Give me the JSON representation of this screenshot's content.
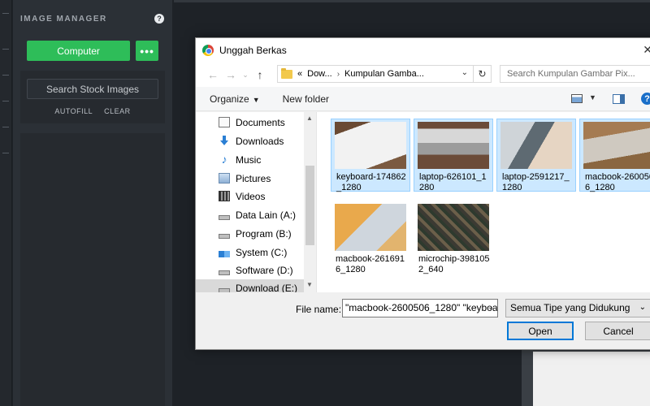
{
  "app": {
    "panel_title": "IMAGE MANAGER",
    "help_glyph": "?",
    "computer_label": "Computer",
    "more_label": "•••",
    "stock_label": "Search Stock Images",
    "autofill_label": "AUTOFILL",
    "clear_label": "CLEAR"
  },
  "dialog": {
    "title": "Unggah Berkas",
    "breadcrumb": {
      "prefix": "«",
      "parts": [
        "Dow...",
        "Kumpulan Gamba..."
      ]
    },
    "search_placeholder": "Search Kumpulan Gambar Pix...",
    "toolbar": {
      "organize": "Organize",
      "new_folder": "New folder"
    },
    "nav_items": [
      {
        "label": "Documents",
        "icon": "documents-icon"
      },
      {
        "label": "Downloads",
        "icon": "downloads-icon"
      },
      {
        "label": "Music",
        "icon": "music-icon"
      },
      {
        "label": "Pictures",
        "icon": "pictures-icon"
      },
      {
        "label": "Videos",
        "icon": "videos-icon"
      },
      {
        "label": "Data Lain (A:)",
        "icon": "drive-icon"
      },
      {
        "label": "Program (B:)",
        "icon": "drive-icon"
      },
      {
        "label": "System (C:)",
        "icon": "system-drive-icon"
      },
      {
        "label": "Software (D:)",
        "icon": "drive-icon"
      },
      {
        "label": "Download (E:)",
        "icon": "drive-icon"
      }
    ],
    "files": [
      {
        "name": "keyboard-174862_1280",
        "selected": true
      },
      {
        "name": "laptop-626101_1280",
        "selected": true
      },
      {
        "name": "laptop-2591217_1280",
        "selected": true
      },
      {
        "name": "macbook-2600506_1280",
        "selected": true
      },
      {
        "name": "macbook-2616916_1280",
        "selected": false
      },
      {
        "name": "microchip-3981052_640",
        "selected": false
      }
    ],
    "file_name_label": "File name:",
    "file_name_value": "\"macbook-2600506_1280\" \"keyboa",
    "file_type": "Semua Tipe yang Didukung",
    "open_label": "Open",
    "cancel_label": "Cancel",
    "colors": {
      "selection": "#cce8ff",
      "accent": "#0078d7",
      "green": "#2ebd59"
    }
  }
}
